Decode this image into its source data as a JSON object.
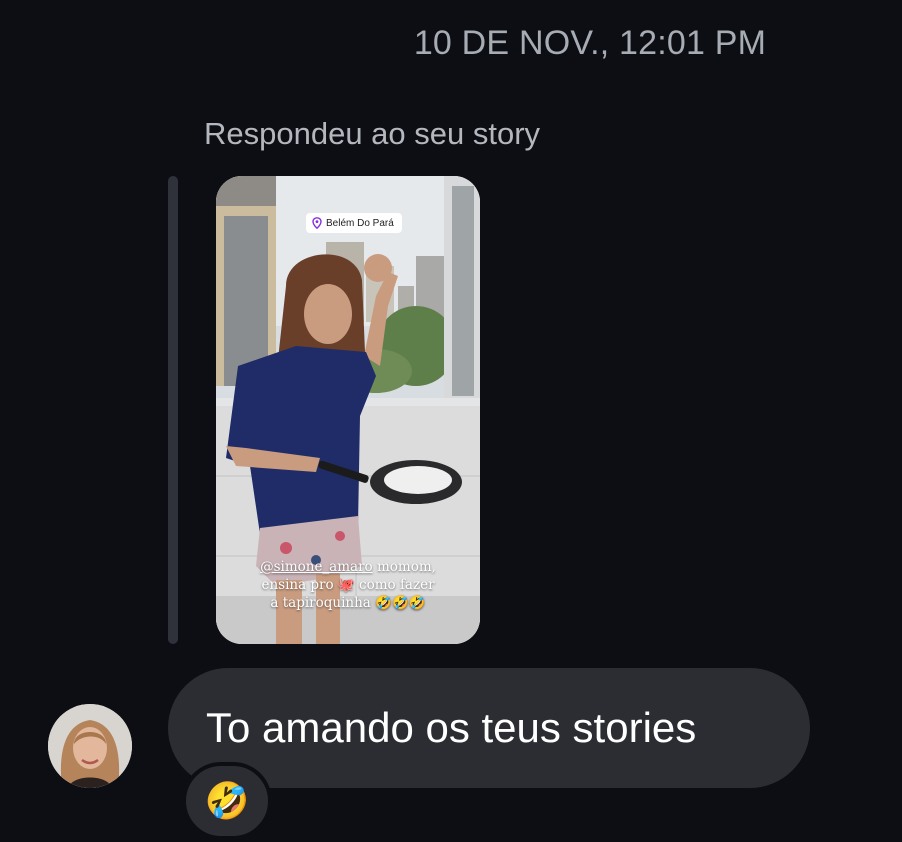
{
  "thread": {
    "timestamp": "10 DE NOV., 12:01 PM",
    "reply_label": "Respondeu ao seu story"
  },
  "story": {
    "location": "Belém Do Pará",
    "caption_mention": "@simone_amaro",
    "caption_line1_rest": " momom,",
    "caption_line2": "ensina pro 🐙 como fazer",
    "caption_line3": "a tapiroquinha 🤣🤣🤣"
  },
  "message": {
    "text": "To amando os teus stories",
    "reaction": "🤣"
  },
  "colors": {
    "background": "#0c0e14",
    "bubble": "#2b2d33",
    "muted_text": "#a7abb3"
  }
}
